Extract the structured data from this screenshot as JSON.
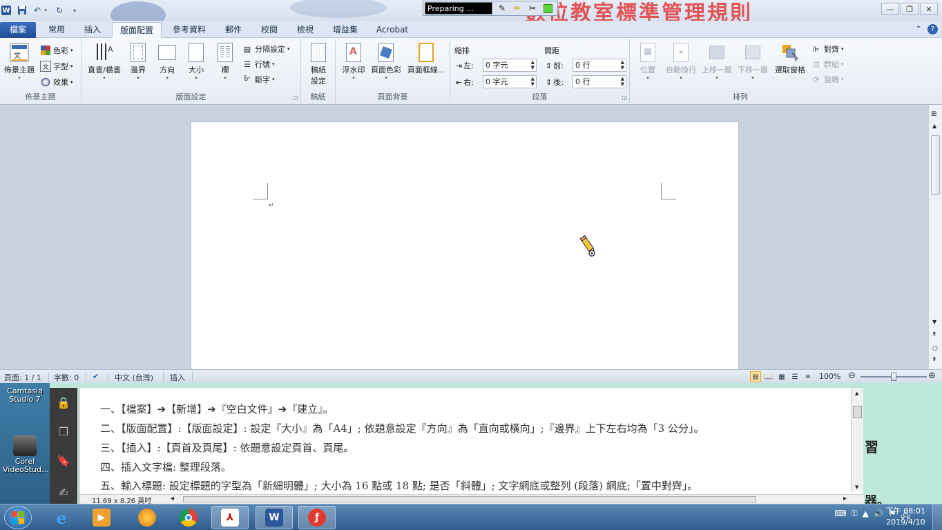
{
  "titlebar": {
    "app_icon": "W",
    "deco_text": "數位教室標準管理規則",
    "recorder_status": "Preparing ..."
  },
  "tabs": {
    "file": "檔案",
    "items": [
      "常用",
      "插入",
      "版面配置",
      "參考資料",
      "郵件",
      "校閱",
      "檢視",
      "增益集",
      "Acrobat"
    ],
    "active": "版面配置"
  },
  "ribbon": {
    "theme": {
      "label": "佈景主題",
      "themes_btn": "佈景主題",
      "colors": "色彩",
      "fonts": "字型",
      "effects": "效果"
    },
    "page_setup": {
      "label": "版面設定",
      "text_direction": "直書/橫書",
      "margins": "邊界",
      "orientation": "方向",
      "size": "大小",
      "columns": "欄",
      "breaks": "分隔設定",
      "line_numbers": "行號",
      "hyphenation": "斷字"
    },
    "draft": {
      "label": "稿紙",
      "btn_line1": "稿紙",
      "btn_line2": "設定"
    },
    "page_background": {
      "label": "頁面背景",
      "watermark": "浮水印",
      "page_color": "頁面色彩",
      "page_borders": "頁面框線..."
    },
    "paragraph": {
      "label": "段落",
      "indent_title": "縮排",
      "indent_left_label": "左:",
      "indent_left_value": "0 字元",
      "indent_right_label": "右:",
      "indent_right_value": "0 字元",
      "spacing_title": "間距",
      "spacing_before_label": "前:",
      "spacing_before_value": "0 行",
      "spacing_after_label": "後:",
      "spacing_after_value": "0 行"
    },
    "arrange": {
      "label": "排列",
      "position": "位置",
      "wrap_text": "自動換行",
      "bring_forward": "上移一層",
      "send_backward": "下移一層",
      "selection_pane": "選取窗格",
      "align": "對齊",
      "group": "群組",
      "rotate": "旋轉"
    }
  },
  "document": {
    "paragraph_mark": "↵"
  },
  "statusbar": {
    "page": "頁面: 1 / 1",
    "words": "字數: 0",
    "language": "中文 (台灣)",
    "mode": "插入",
    "zoom": "100%"
  },
  "desktop": {
    "icon1": "Camtasia Studio 7",
    "icon2": "Corel VideoStud..."
  },
  "instructions": {
    "lines": [
      "一、【檔案】➔【新增】➔『空白文件』➔『建立』。",
      "二、【版面配置】:【版面設定】: 設定『大小』為「A4」; 依題意設定『方向』為「直向或橫向」;『邊界』上下左右均為「3 公分」。",
      "三、【插入】:【頁首及頁尾】: 依題意設定頁首、頁尾。",
      "四、插入文字檔: 整理段落。",
      "五、輸入標題: 設定標題的字型為「新細明體」; 大小為 16 點或 18 點; 是否「斜體」; 文字網底或整列 (段落) 網底;「置中對齊」。"
    ],
    "page_size": "11.69 x 8.26 英吋"
  },
  "right_edge": {
    "text1": "習",
    "text2": "器。"
  },
  "taskbar": {
    "clock_time": "下午 08:01",
    "clock_date": "2019/4/10"
  }
}
